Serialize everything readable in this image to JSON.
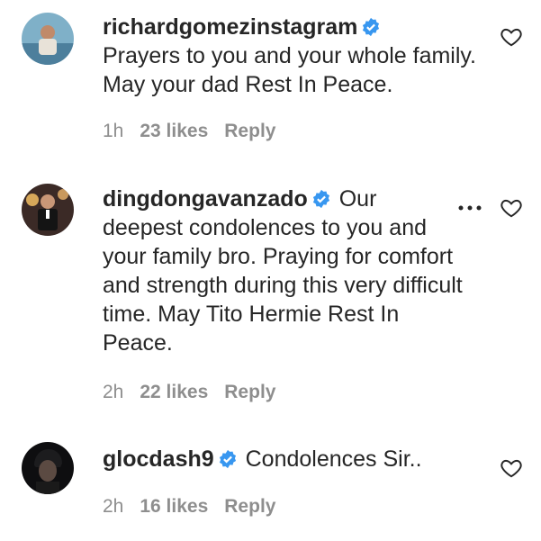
{
  "comments": [
    {
      "username": "richardgomezinstagram",
      "text": "Prayers to you and your whole family. May your dad Rest In Peace.",
      "time": "1h",
      "likes": "23 likes",
      "reply": "Reply"
    },
    {
      "username": "dingdongavanzado",
      "text": "Our deepest condolences to you and your family bro. Praying for comfort and strength during this very difficult time. May Tito Hermie Rest In Peace.",
      "time": "2h",
      "likes": "22 likes",
      "reply": "Reply"
    },
    {
      "username": "glocdash9",
      "text": "Condolences Sir..",
      "time": "2h",
      "likes": "16 likes",
      "reply": "Reply"
    }
  ],
  "icons": {
    "verified": "verified-badge-icon",
    "like": "heart-outline-icon",
    "more": "more-options-icon"
  },
  "colors": {
    "verified_blue": "#3897f0",
    "meta_gray": "#8e8e8e",
    "text": "#262626"
  }
}
